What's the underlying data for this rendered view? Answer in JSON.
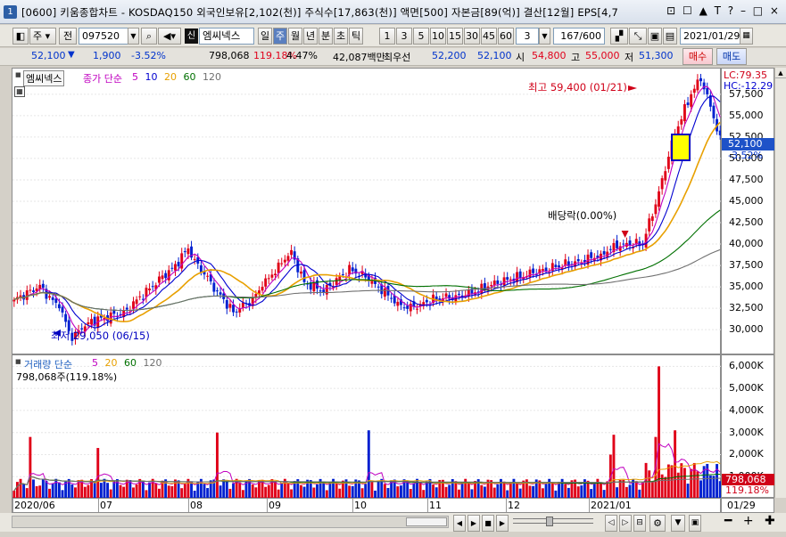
{
  "titlebar": {
    "number": "1",
    "title": "[0600] 키움종합차트 - KOSDAQ150 외국인보유[2,102(천)] 주식수[17,863(천)] 액면[500] 자본금[89(억)] 결산[12월] EPS[4,7",
    "icons": "⊡ ☐ ▲ T ? – □ ×"
  },
  "toolbar": {
    "period_unit": "주",
    "prev_label": "전",
    "code": "097520",
    "badge": "신",
    "stock_name": "엠씨넥스",
    "periods": [
      "일",
      "주",
      "월",
      "년",
      "분",
      "초",
      "틱"
    ],
    "minutes": [
      "1",
      "3",
      "5",
      "10",
      "15",
      "30",
      "45",
      "60"
    ],
    "custom_min": "3",
    "count": "167/600",
    "date": "2021/01/29"
  },
  "quote": {
    "price": "52,100",
    "change": "1,900",
    "change_pct": "-3.52%",
    "volume": "798,068",
    "vol_ratio": "119.18%",
    "turnover": "4.47%",
    "amount": "42,087백만",
    "pref_label": "최우선",
    "ask": "52,200",
    "bid": "52,100",
    "open_label": "시",
    "open": "54,800",
    "high_label": "고",
    "high": "55,000",
    "low_label": "저",
    "low": "51,300",
    "buy_label": "매수",
    "sell_label": "매도"
  },
  "price_panel": {
    "stock_tag": "엠씨넥스",
    "ma_title": "종가 단순",
    "ma_periods": [
      "5",
      "10",
      "20",
      "60",
      "120"
    ],
    "ma_colors": [
      "#c000c0",
      "#0000d0",
      "#e8a000",
      "#007000",
      "#707070"
    ],
    "lc": "LC:79.35",
    "hc": "HC:-12.29",
    "last_price": "52,100",
    "last_pct": "-3.52%",
    "high_note": "최고 59,400 (01/21)",
    "low_note": "최저 29,050 (06/15)",
    "dividend_note": "배당락(0.00%)"
  },
  "volume_panel": {
    "title": "거래량 단순",
    "ma_periods": [
      "5",
      "20",
      "60",
      "120"
    ],
    "value_text": "798,068주(119.18%)",
    "last_value": "798,068",
    "last_pct": "119.18%"
  },
  "x_labels": [
    "2020/06",
    "07",
    "08",
    "09",
    "10",
    "11",
    "12",
    "2021/01"
  ],
  "x_right": "01/29",
  "chart_data": {
    "type": "candlestick",
    "y_ticks_price": [
      "57,500",
      "55,000",
      "52,500",
      "50,000",
      "47,500",
      "45,000",
      "42,500",
      "40,000",
      "37,500",
      "35,000",
      "32,500",
      "30,000"
    ],
    "y_ticks_volume": [
      "6,000K",
      "5,000K",
      "4,000K",
      "3,000K",
      "2,000K",
      "1,000K"
    ],
    "price_range": [
      27000,
      60500
    ],
    "volume_range": [
      0,
      6500000
    ],
    "close_anchors": [
      [
        0,
        33500
      ],
      [
        8,
        35000
      ],
      [
        14,
        32500
      ],
      [
        18,
        29050
      ],
      [
        24,
        31000
      ],
      [
        34,
        32000
      ],
      [
        44,
        35500
      ],
      [
        50,
        37500
      ],
      [
        54,
        39500
      ],
      [
        58,
        37000
      ],
      [
        62,
        35000
      ],
      [
        68,
        32000
      ],
      [
        74,
        33500
      ],
      [
        80,
        36500
      ],
      [
        86,
        39000
      ],
      [
        90,
        35500
      ],
      [
        96,
        34500
      ],
      [
        104,
        37000
      ],
      [
        110,
        36000
      ],
      [
        116,
        34000
      ],
      [
        122,
        32500
      ],
      [
        130,
        33500
      ],
      [
        140,
        34000
      ],
      [
        150,
        35500
      ],
      [
        160,
        36500
      ],
      [
        170,
        37500
      ],
      [
        180,
        38500
      ],
      [
        188,
        40000
      ],
      [
        195,
        40000
      ],
      [
        200,
        46000
      ],
      [
        205,
        53000
      ],
      [
        210,
        57500
      ],
      [
        213,
        59400
      ],
      [
        216,
        56000
      ],
      [
        219,
        52100
      ]
    ],
    "volume_spikes": [
      [
        5,
        2800000
      ],
      [
        26,
        2300000
      ],
      [
        63,
        3000000
      ],
      [
        110,
        3100000
      ],
      [
        185,
        2000000
      ],
      [
        186,
        2900000
      ],
      [
        199,
        2800000
      ],
      [
        200,
        6000000
      ],
      [
        205,
        3100000
      ]
    ],
    "volume_base": 600000,
    "dividend_index": 190
  }
}
